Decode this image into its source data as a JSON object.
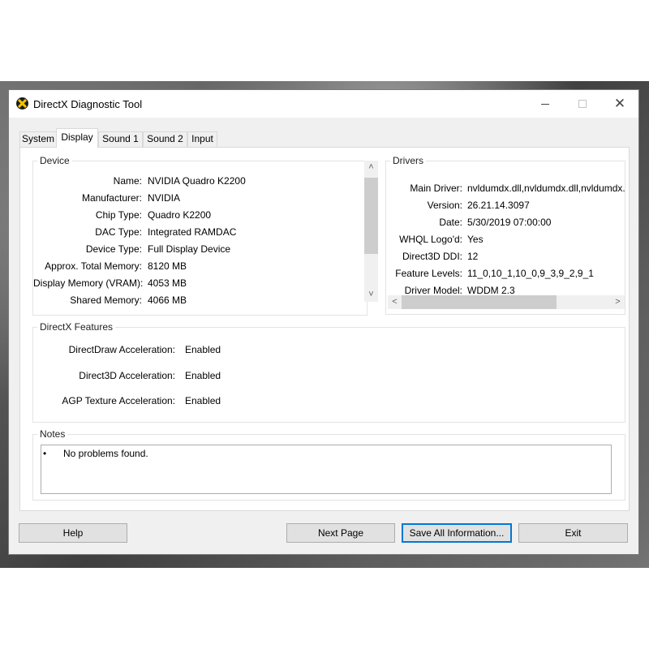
{
  "window": {
    "title": "DirectX Diagnostic Tool",
    "minimize_icon": "minimize-icon",
    "maximize_icon": "maximize-icon",
    "close_label": "✕"
  },
  "tabs": [
    {
      "label": "System"
    },
    {
      "label": "Display"
    },
    {
      "label": "Sound 1"
    },
    {
      "label": "Sound 2"
    },
    {
      "label": "Input"
    }
  ],
  "active_tab": "Display",
  "device": {
    "group_label": "Device",
    "rows": [
      {
        "label": "Name:",
        "value": "NVIDIA Quadro K2200"
      },
      {
        "label": "Manufacturer:",
        "value": "NVIDIA"
      },
      {
        "label": "Chip Type:",
        "value": "Quadro K2200"
      },
      {
        "label": "DAC Type:",
        "value": "Integrated RAMDAC"
      },
      {
        "label": "Device Type:",
        "value": "Full Display Device"
      },
      {
        "label": "Approx. Total Memory:",
        "value": "8120 MB"
      },
      {
        "label": "Display Memory (VRAM):",
        "value": "4053 MB"
      },
      {
        "label": "Shared Memory:",
        "value": "4066 MB"
      }
    ]
  },
  "drivers": {
    "group_label": "Drivers",
    "rows": [
      {
        "label": "Main Driver:",
        "value": "nvldumdx.dll,nvldumdx.dll,nvldumdx.d"
      },
      {
        "label": "Version:",
        "value": "26.21.14.3097"
      },
      {
        "label": "Date:",
        "value": "5/30/2019 07:00:00"
      },
      {
        "label": "WHQL Logo'd:",
        "value": "Yes"
      },
      {
        "label": "Direct3D DDI:",
        "value": "12"
      },
      {
        "label": "Feature Levels:",
        "value": "11_0,10_1,10_0,9_3,9_2,9_1"
      },
      {
        "label": "Driver Model:",
        "value": "WDDM 2.3"
      }
    ]
  },
  "features": {
    "group_label": "DirectX Features",
    "rows": [
      {
        "label": "DirectDraw Acceleration:",
        "value": "Enabled"
      },
      {
        "label": "Direct3D Acceleration:",
        "value": "Enabled"
      },
      {
        "label": "AGP Texture Acceleration:",
        "value": "Enabled"
      }
    ]
  },
  "notes": {
    "group_label": "Notes",
    "bullet": "•",
    "items": [
      "No problems found."
    ]
  },
  "scroll_arrows": {
    "up": "˄",
    "down": "˅",
    "left": "<",
    "right": ">"
  },
  "buttons": {
    "help": "Help",
    "next_page": "Next Page",
    "save_all": "Save All Information...",
    "exit": "Exit"
  }
}
